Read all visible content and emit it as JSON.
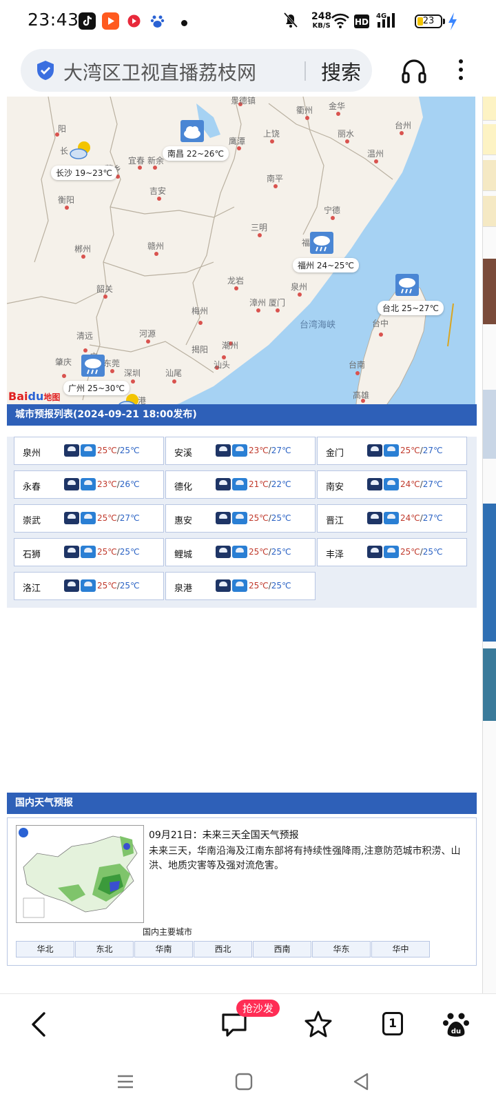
{
  "status_bar": {
    "time": "23:43",
    "net_speed": "248",
    "net_unit": "KB/S",
    "battery": "23",
    "icons": [
      "tiktok-icon",
      "video-app-icon",
      "music-app-icon",
      "baidu-app-icon",
      "mute-bell-icon",
      "wifi-icon",
      "hd-icon",
      "4g-signal-icon",
      "battery-icon",
      "charging-icon"
    ]
  },
  "browser": {
    "url_title": "大湾区卫视直播荔枝网",
    "search_label": "搜索"
  },
  "map": {
    "cities": [
      "景德镇",
      "衢州",
      "金华",
      "台州",
      "丽水",
      "温州",
      "长",
      "阳",
      "宜春",
      "新余",
      "鹰潭",
      "上饶",
      "萍乡",
      "吉安",
      "衡阳",
      "南平",
      "宁德",
      "三明",
      "赣州",
      "郴州",
      "福",
      "龙岩",
      "泉州",
      "漳州",
      "厦门",
      "韶关",
      "梅州",
      "清远",
      "河源",
      "揭阳",
      "潮州",
      "汕头",
      "汕尾",
      "肇庆",
      "东莞",
      "深圳",
      "广",
      "台中",
      "台南",
      "高雄",
      "港"
    ],
    "weather_labels": [
      {
        "city": "长沙",
        "range": "19~23℃"
      },
      {
        "city": "南昌",
        "range": "22~26℃"
      },
      {
        "city": "福州",
        "range": "24~25℃"
      },
      {
        "city": "台北",
        "range": "25~27℃"
      },
      {
        "city": "广州",
        "range": "25~30℃"
      }
    ],
    "sea_label": "台湾海峡",
    "logo_text": "Bai",
    "logo_suffix": "地图"
  },
  "forecast": {
    "title": "城市预报列表(2024-09-21 18:00发布)",
    "cities": [
      {
        "name": "泉州",
        "high": "25℃",
        "low": "25℃"
      },
      {
        "name": "安溪",
        "high": "23℃",
        "low": "27℃"
      },
      {
        "name": "金门",
        "high": "25℃",
        "low": "27℃"
      },
      {
        "name": "永春",
        "high": "23℃",
        "low": "26℃"
      },
      {
        "name": "德化",
        "high": "21℃",
        "low": "22℃"
      },
      {
        "name": "南安",
        "high": "24℃",
        "low": "27℃"
      },
      {
        "name": "崇武",
        "high": "25℃",
        "low": "27℃"
      },
      {
        "name": "惠安",
        "high": "25℃",
        "low": "25℃"
      },
      {
        "name": "晋江",
        "high": "24℃",
        "low": "27℃"
      },
      {
        "name": "石狮",
        "high": "25℃",
        "low": "25℃"
      },
      {
        "name": "鲤城",
        "high": "25℃",
        "low": "25℃"
      },
      {
        "name": "丰泽",
        "high": "25℃",
        "low": "25℃"
      },
      {
        "name": "洛江",
        "high": "25℃",
        "low": "25℃"
      },
      {
        "name": "泉港",
        "high": "25℃",
        "low": "25℃"
      }
    ]
  },
  "national": {
    "title": "国内天气预报",
    "headline": "09月21日：未来三天全国天气预报",
    "body": "未来三天，华南沿海及江南东部将有持续性强降雨,注意防范城市积涝、山洪、地质灾害等及强对流危害。",
    "caption": "国内主要城市",
    "regions": [
      "华北",
      "东北",
      "华南",
      "西北",
      "西南",
      "华东",
      "华中"
    ]
  },
  "bottom_nav": {
    "badge": "抢沙发",
    "tab_count": "1"
  },
  "colors": {
    "section_bar": "#2e60b8",
    "temp_high": "#c0392b",
    "temp_low": "#2a62c4",
    "sea": "#a6d2f3",
    "badge": "#ff2d55"
  }
}
